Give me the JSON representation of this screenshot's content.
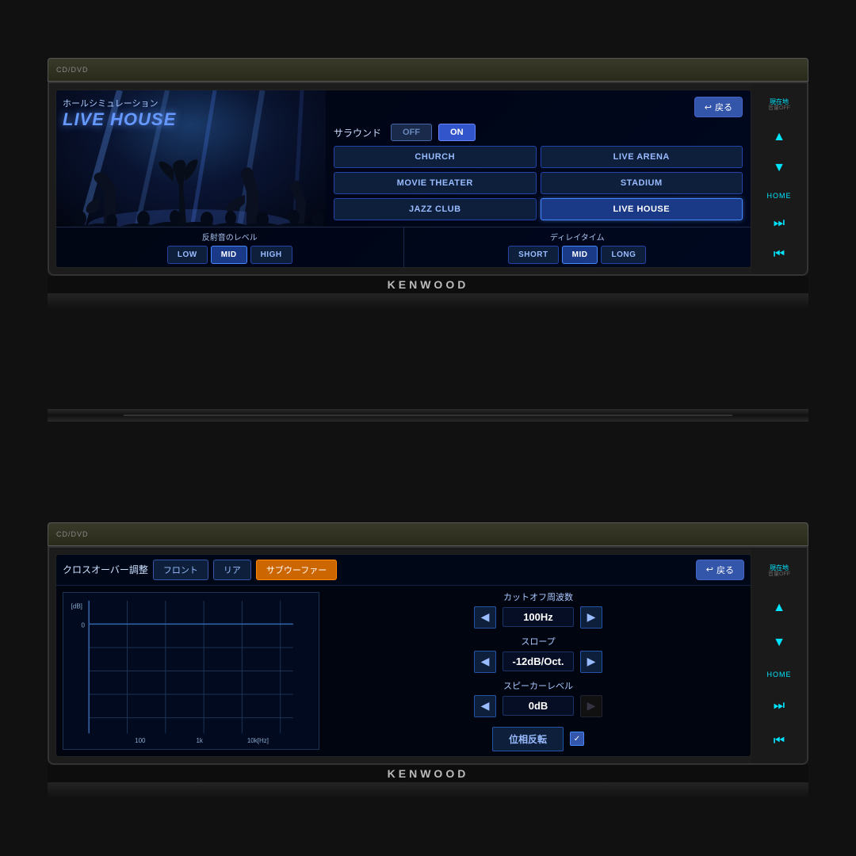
{
  "unit1": {
    "brand": "KENWOOD",
    "screen": {
      "title_jp": "ホールシミュレーション",
      "title_en": "LIVE HOUSE",
      "back_label": "戻る",
      "surround_label": "サラウンド",
      "toggle_off": "OFF",
      "toggle_on": "ON",
      "venues": [
        {
          "label": "CHURCH",
          "active": false
        },
        {
          "label": "LIVE ARENA",
          "active": false
        },
        {
          "label": "MOVIE THEATER",
          "active": false
        },
        {
          "label": "STADIUM",
          "active": false
        },
        {
          "label": "JAZZ CLUB",
          "active": false
        },
        {
          "label": "LIVE HOUSE",
          "active": true
        }
      ],
      "reflection_label": "反射音のレベル",
      "reflection_buttons": [
        {
          "label": "LOW",
          "active": false
        },
        {
          "label": "MID",
          "active": true
        },
        {
          "label": "HIGH",
          "active": false
        }
      ],
      "delay_label": "ディレイタイム",
      "delay_buttons": [
        {
          "label": "SHORT",
          "active": false
        },
        {
          "label": "MID",
          "active": true
        },
        {
          "label": "LONG",
          "active": false
        }
      ]
    },
    "right_panel": {
      "source_label": "現在地",
      "source_sub": "音量OFF",
      "up_arrow": "▲",
      "down_arrow": "▼",
      "home_label": "HOME",
      "skip_fwd": "⏭",
      "skip_back": "⏮"
    }
  },
  "unit2": {
    "brand": "KENWOOD",
    "screen": {
      "title_jp": "クロスオーバー調整",
      "tabs": [
        {
          "label": "フロント",
          "active": false
        },
        {
          "label": "リア",
          "active": false
        },
        {
          "label": "サブウーファー",
          "active": true
        }
      ],
      "back_label": "戻る",
      "cutoff_label": "カットオフ周波数",
      "cutoff_value": "100Hz",
      "slope_label": "スロープ",
      "slope_value": "-12dB/Oct.",
      "speaker_label": "スピーカーレベル",
      "speaker_value": "0dB",
      "phase_label": "位相反転",
      "graph": {
        "db_label": "[dB]",
        "zero_label": "0",
        "x_labels": [
          "100",
          "1k",
          "10k[Hz]"
        ]
      }
    },
    "right_panel": {
      "source_label": "現在地",
      "source_sub": "音量OFF",
      "up_arrow": "▲",
      "down_arrow": "▼",
      "home_label": "HOME",
      "skip_fwd": "⏭",
      "skip_back": "⏮"
    }
  }
}
